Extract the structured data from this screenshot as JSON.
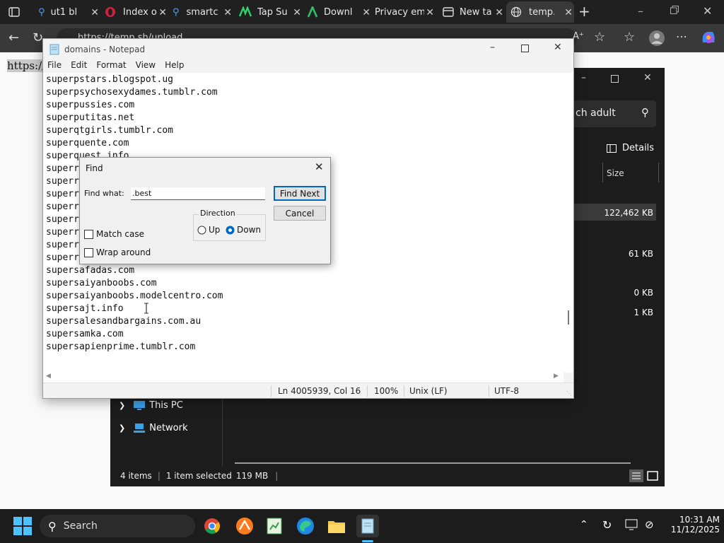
{
  "browser": {
    "tabs": [
      {
        "label": "ut1 bl",
        "icon": "search-icon"
      },
      {
        "label": "Index o",
        "icon": "opera-icon"
      },
      {
        "label": "smartc",
        "icon": "search-icon"
      },
      {
        "label": "Tap Su",
        "icon": "tapsu-icon"
      },
      {
        "label": "Downl",
        "icon": "download-site-icon"
      },
      {
        "label": "Privacy em",
        "icon": "privacy-icon"
      },
      {
        "label": "New ta",
        "icon": "newtab-icon"
      },
      {
        "label": "temp.",
        "icon": "globe-icon"
      }
    ],
    "address_url": "https://temp.sh/upload",
    "page_text": "https://t"
  },
  "explorer": {
    "search_text": "ch adult",
    "details_label": "Details",
    "size_header": "Size",
    "sizes": [
      "122,462 KB",
      "61 KB",
      "0 KB",
      "1 KB"
    ],
    "nav": [
      {
        "label": "This PC",
        "icon": "computer-icon"
      },
      {
        "label": "Network",
        "icon": "network-icon"
      }
    ],
    "status": {
      "items": "4 items",
      "selected": "1 item selected",
      "size": "119 MB"
    }
  },
  "notepad": {
    "title": "domains - Notepad",
    "menu": [
      "File",
      "Edit",
      "Format",
      "View",
      "Help"
    ],
    "lines": [
      "superpstars.blogspot.ug",
      "superpsychosexydames.tumblr.com",
      "superpussies.com",
      "superputitas.net",
      "superqtgirls.tumblr.com",
      "superquente.com",
      "superquest.info",
      "superr",
      "superr",
      "superr",
      "superr",
      "superr",
      "superr",
      "superr",
      "superrsmutt.tumblr.com",
      "supersafadas.com",
      "supersaiyanboobs.com",
      "supersaiyanboobs.modelcentro.com",
      "supersajt.info",
      "supersalesandbargains.com.au",
      "supersamka.com",
      "supersapienprime.tumblr.com"
    ],
    "status": {
      "position": "Ln 4005939, Col 16",
      "zoom": "100%",
      "eol": "Unix (LF)",
      "encoding": "UTF-8"
    }
  },
  "find": {
    "title": "Find",
    "find_what_label": "Find what:",
    "find_what_value": ".best",
    "find_next": "Find Next",
    "cancel": "Cancel",
    "direction_label": "Direction",
    "up_label": "Up",
    "down_label": "Down",
    "match_case": "Match case",
    "wrap_around": "Wrap around"
  },
  "taskbar": {
    "search_label": "Search",
    "time": "10:31 AM",
    "date": "11/12/2025"
  },
  "colors": {
    "accent": "#0067c0",
    "taskbar": "#1c1c1c",
    "explorer_bg": "#1c1c1c"
  }
}
